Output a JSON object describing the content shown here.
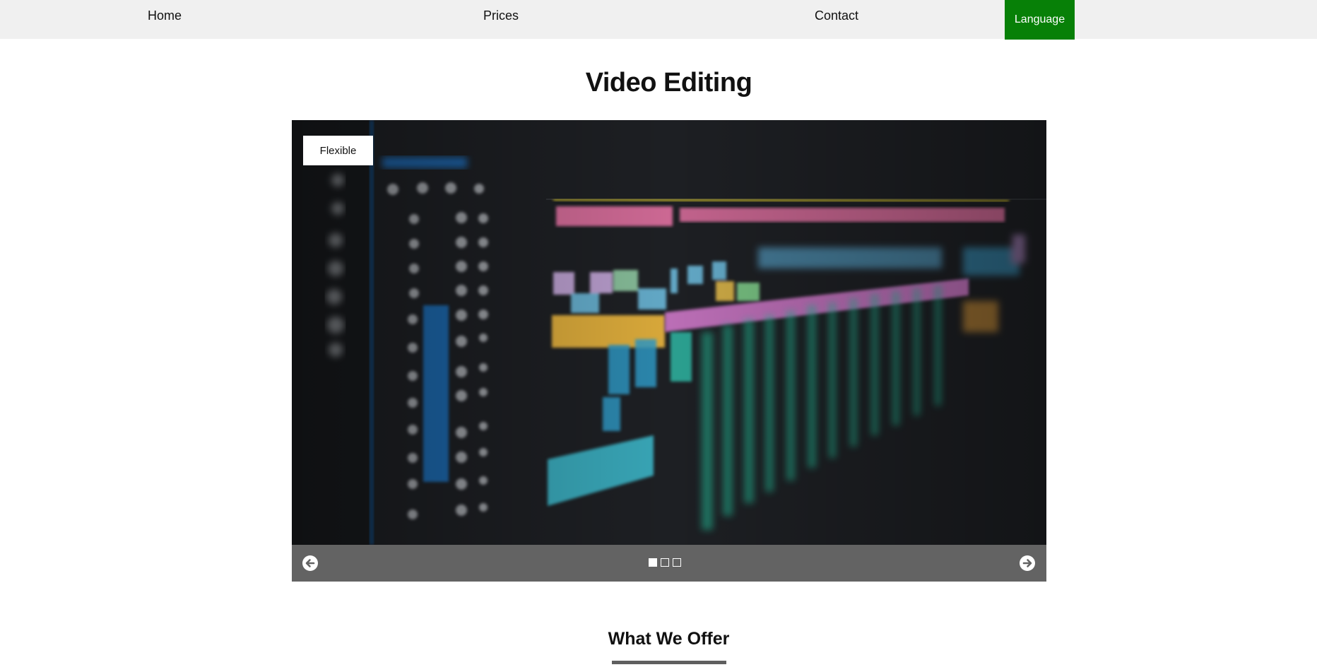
{
  "nav": {
    "items": [
      "Home",
      "Prices",
      "Contact"
    ],
    "language_label": "Language",
    "language_color": "#078007",
    "background": "#f0f0f0"
  },
  "page": {
    "title": "Video Editing"
  },
  "slider": {
    "slide_label": "Flexible",
    "image": "blurred video editing timeline with colored audio and video tracks",
    "current_slide": 1,
    "slide_count": 3,
    "prev_icon": "arrow-left-circle-icon",
    "next_icon": "arrow-right-circle-icon",
    "controls_color": "#636363"
  },
  "section": {
    "title": "What We Offer"
  }
}
